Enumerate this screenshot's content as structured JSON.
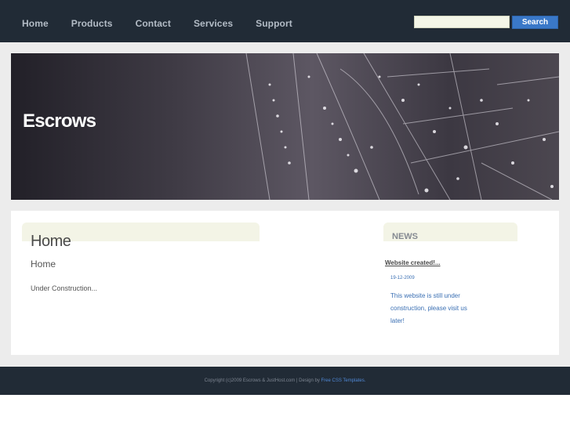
{
  "nav": {
    "items": [
      "Home",
      "Products",
      "Contact",
      "Services",
      "Support"
    ]
  },
  "search": {
    "placeholder": "",
    "button_label": "Search"
  },
  "banner": {
    "title": "Escrows"
  },
  "main": {
    "title": "Home",
    "subtitle": "Home",
    "body": "Under Construction..."
  },
  "news": {
    "heading": "NEWS",
    "item_title": "Website created!...",
    "item_date": "19-12-2009",
    "item_text": "This website is still under construction, please visit us later!"
  },
  "footer": {
    "text": "Copyright (c)2009 Escrows & JustHost.com | Design by",
    "link": "Free CSS Templates."
  }
}
